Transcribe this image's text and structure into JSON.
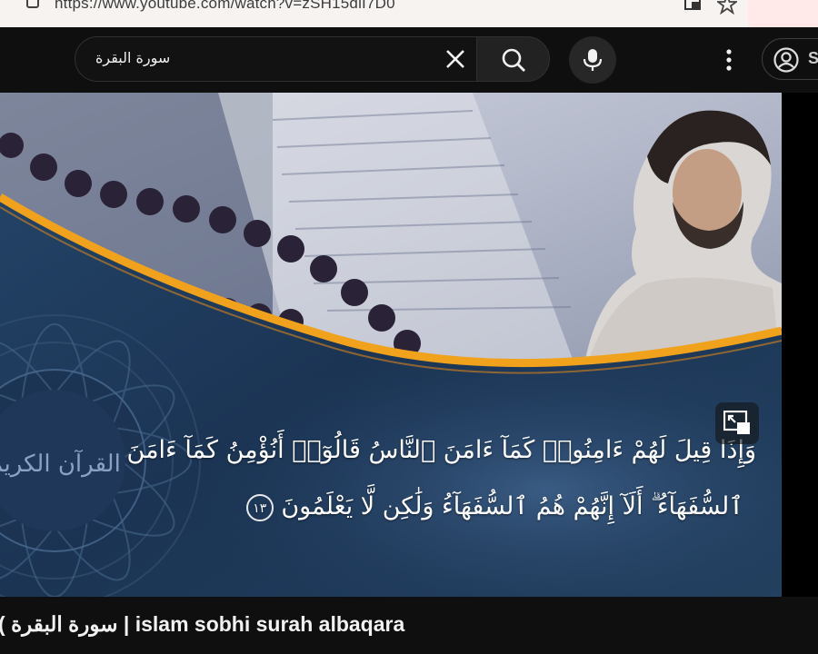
{
  "browser": {
    "url": "https://www.youtube.com/watch?v=zSH15dlI7D0",
    "icons": [
      "lock-icon",
      "extension-icon",
      "star-icon"
    ]
  },
  "header": {
    "search": {
      "value": "سورة البقرة",
      "clear_icon": "close-icon",
      "button_icon": "search-icon"
    },
    "mic_icon": "mic-icon",
    "more_icon": "more-vert-icon",
    "signin": {
      "label": "S",
      "icon": "account-icon"
    }
  },
  "video": {
    "overlay_icon": "miniplayer-icon",
    "verse_line_1": "وَإِذَا قِيلَ لَهُمْ ءَامِنُوا۟ كَمَآ ءَامَنَ ٱلنَّاسُ قَالُوٓا۟ أَنُؤْمِنُ كَمَآ ءَامَنَ",
    "verse_line_2": "ٱلسُّفَهَآءُ ۗ أَلَآ إِنَّهُمْ هُمُ ٱلسُّفَهَآءُ وَلَٰكِن لَّا يَعْلَمُونَ",
    "ayah_number": "١٣",
    "calligraphy": "القرآن الكريم",
    "colors": {
      "background": "#1e3552",
      "accent_gold": "#f0a21c"
    }
  },
  "title": "( سورة البقرة | islam sobhi surah albaqara"
}
